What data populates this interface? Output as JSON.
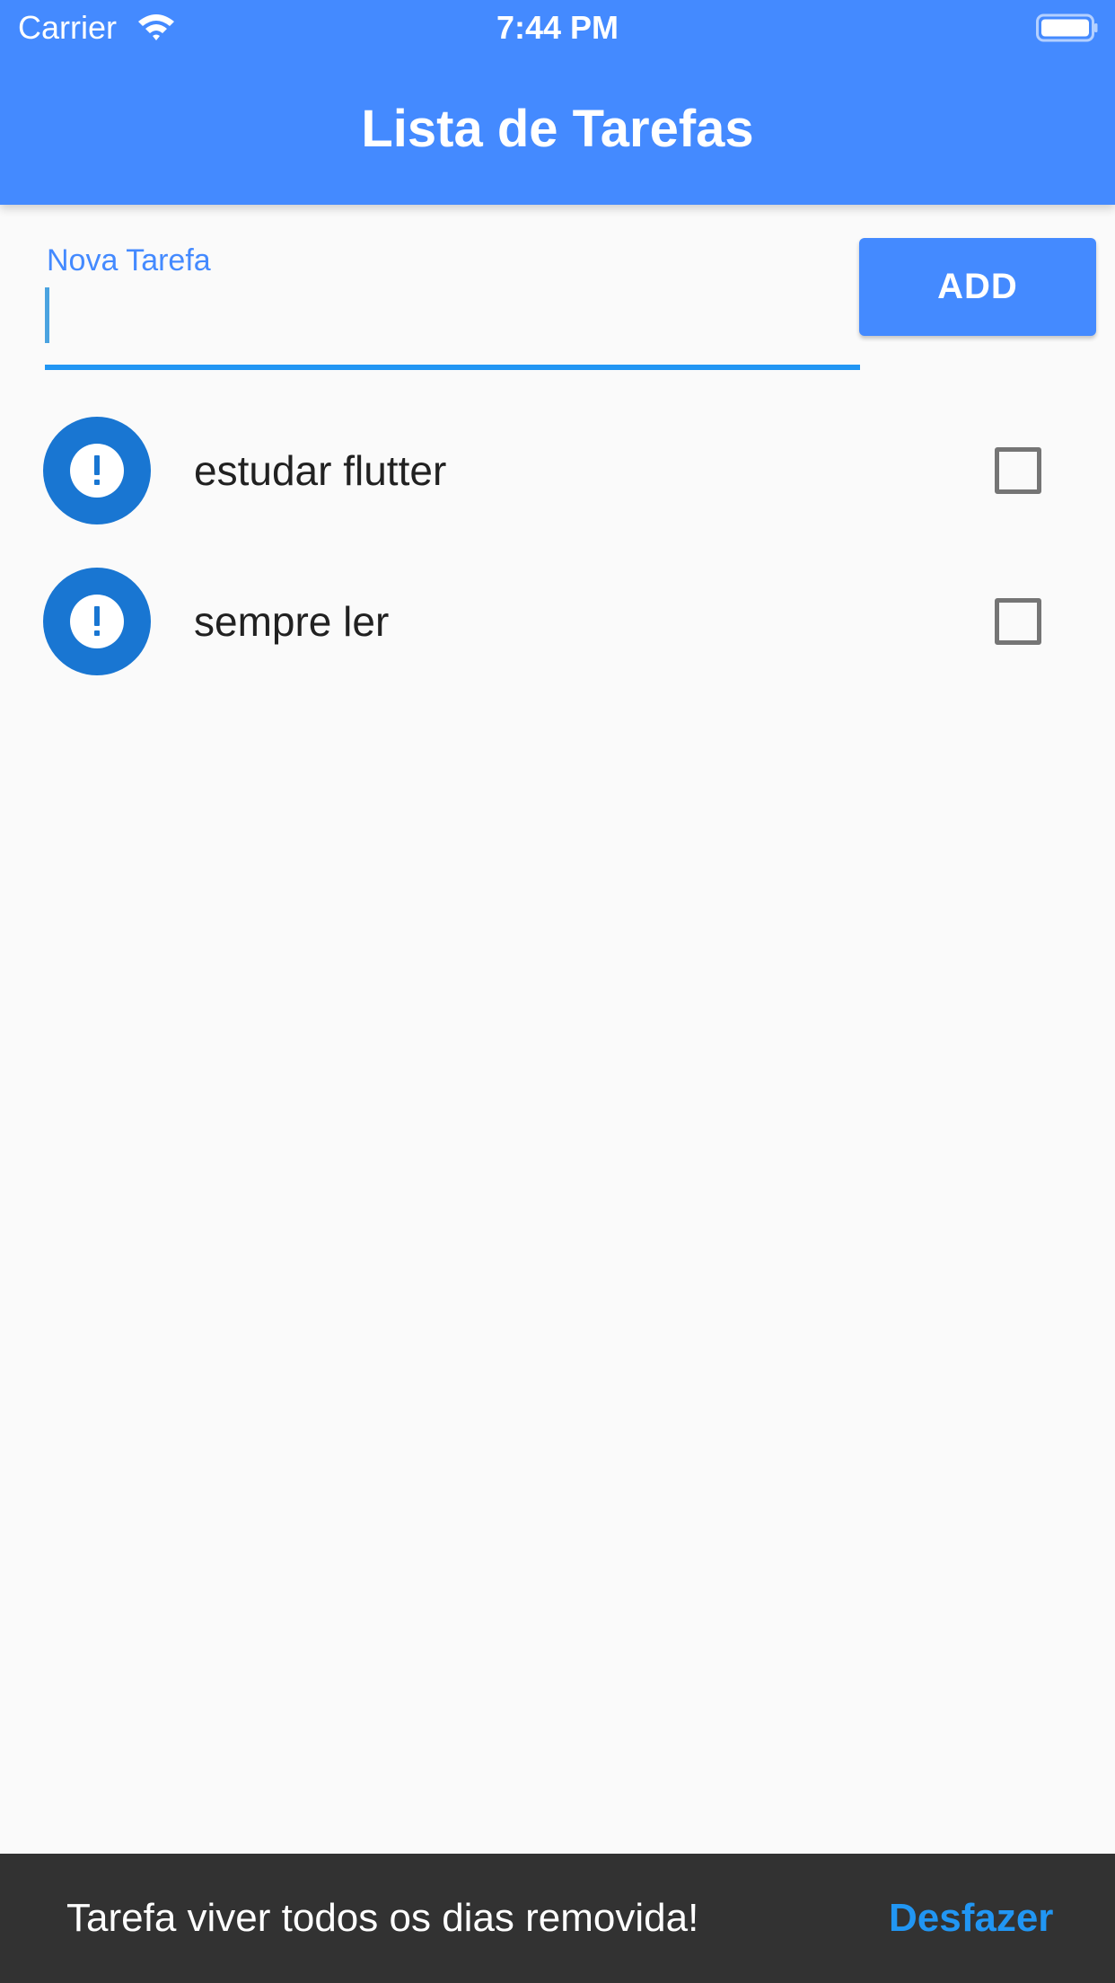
{
  "status_bar": {
    "carrier": "Carrier",
    "time": "7:44 PM",
    "wifi_icon": "wifi-icon",
    "battery_icon": "battery-icon"
  },
  "app_bar": {
    "title": "Lista de Tarefas",
    "color": "#448aff"
  },
  "new_task": {
    "label": "Nova Tarefa",
    "value": "",
    "accent": "#2196f3"
  },
  "add_button": {
    "label": "ADD"
  },
  "tasks": [
    {
      "title": "estudar flutter",
      "icon": "alert-icon",
      "checked": false
    },
    {
      "title": "sempre ler",
      "icon": "alert-icon",
      "checked": false
    }
  ],
  "snackbar": {
    "message": "Tarefa viver todos os dias removida!",
    "action": "Desfazer"
  }
}
